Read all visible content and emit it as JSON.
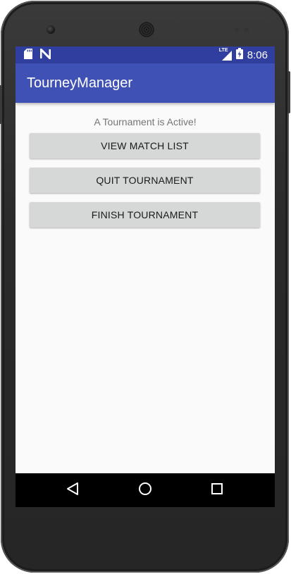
{
  "statusbar": {
    "left_icons": [
      "sd-card-icon",
      "n-notification-icon"
    ],
    "right_icons": [
      "lte-signal-icon",
      "battery-charging-icon"
    ],
    "network_label": "LTE",
    "time": "8:06"
  },
  "appbar": {
    "title": "TourneyManager"
  },
  "main": {
    "status_text": "A Tournament is Active!",
    "buttons": [
      {
        "label": "VIEW MATCH LIST"
      },
      {
        "label": "QUIT TOURNAMENT"
      },
      {
        "label": "FINISH TOURNAMENT"
      }
    ]
  },
  "navbar": {
    "icons": [
      "back-icon",
      "home-icon",
      "recents-icon"
    ]
  },
  "colors": {
    "status_bar": "#303f9f",
    "app_bar": "#3f51b5",
    "background": "#fafafa",
    "button": "#d6d7d7",
    "status_text": "#757575",
    "nav_bar": "#000000"
  }
}
